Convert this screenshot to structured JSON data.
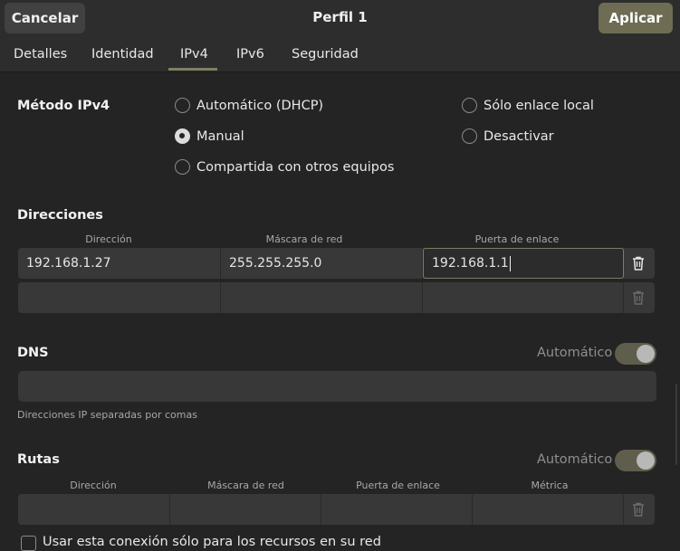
{
  "header": {
    "cancel_label": "Cancelar",
    "title": "Perfil 1",
    "apply_label": "Aplicar"
  },
  "tabs": [
    {
      "label": "Detalles"
    },
    {
      "label": "Identidad"
    },
    {
      "label": "IPv4",
      "active": true
    },
    {
      "label": "IPv6"
    },
    {
      "label": "Seguridad"
    }
  ],
  "method": {
    "label": "Método IPv4",
    "options": [
      {
        "label": "Automático (DHCP)",
        "checked": false
      },
      {
        "label": "Manual",
        "checked": true
      },
      {
        "label": "Compartida con otros equipos",
        "checked": false
      },
      {
        "label": "Sólo enlace local",
        "checked": false
      },
      {
        "label": "Desactivar",
        "checked": false
      }
    ]
  },
  "addresses": {
    "label": "Direcciones",
    "columns": [
      "Dirección",
      "Máscara de red",
      "Puerta de enlace"
    ],
    "rows": [
      {
        "address": "192.168.1.27",
        "netmask": "255.255.255.0",
        "gateway": "192.168.1.1"
      },
      {
        "address": "",
        "netmask": "",
        "gateway": ""
      }
    ]
  },
  "dns": {
    "label": "DNS",
    "auto_label": "Automático",
    "auto_on": true,
    "value": "",
    "hint": "Direcciones IP separadas por comas"
  },
  "routes": {
    "label": "Rutas",
    "auto_label": "Automático",
    "auto_on": true,
    "columns": [
      "Dirección",
      "Máscara de red",
      "Puerta de enlace",
      "Métrica"
    ],
    "rows": [
      {
        "address": "",
        "netmask": "",
        "gateway": "",
        "metric": ""
      }
    ]
  },
  "only_resources": {
    "label": "Usar esta conexión sólo para los recursos en su red"
  },
  "colors": {
    "background": "#242424",
    "header": "#2d2d2d",
    "accent": "#6e6c53",
    "field": "#383838"
  },
  "icons": {
    "delete": "trash-icon"
  }
}
